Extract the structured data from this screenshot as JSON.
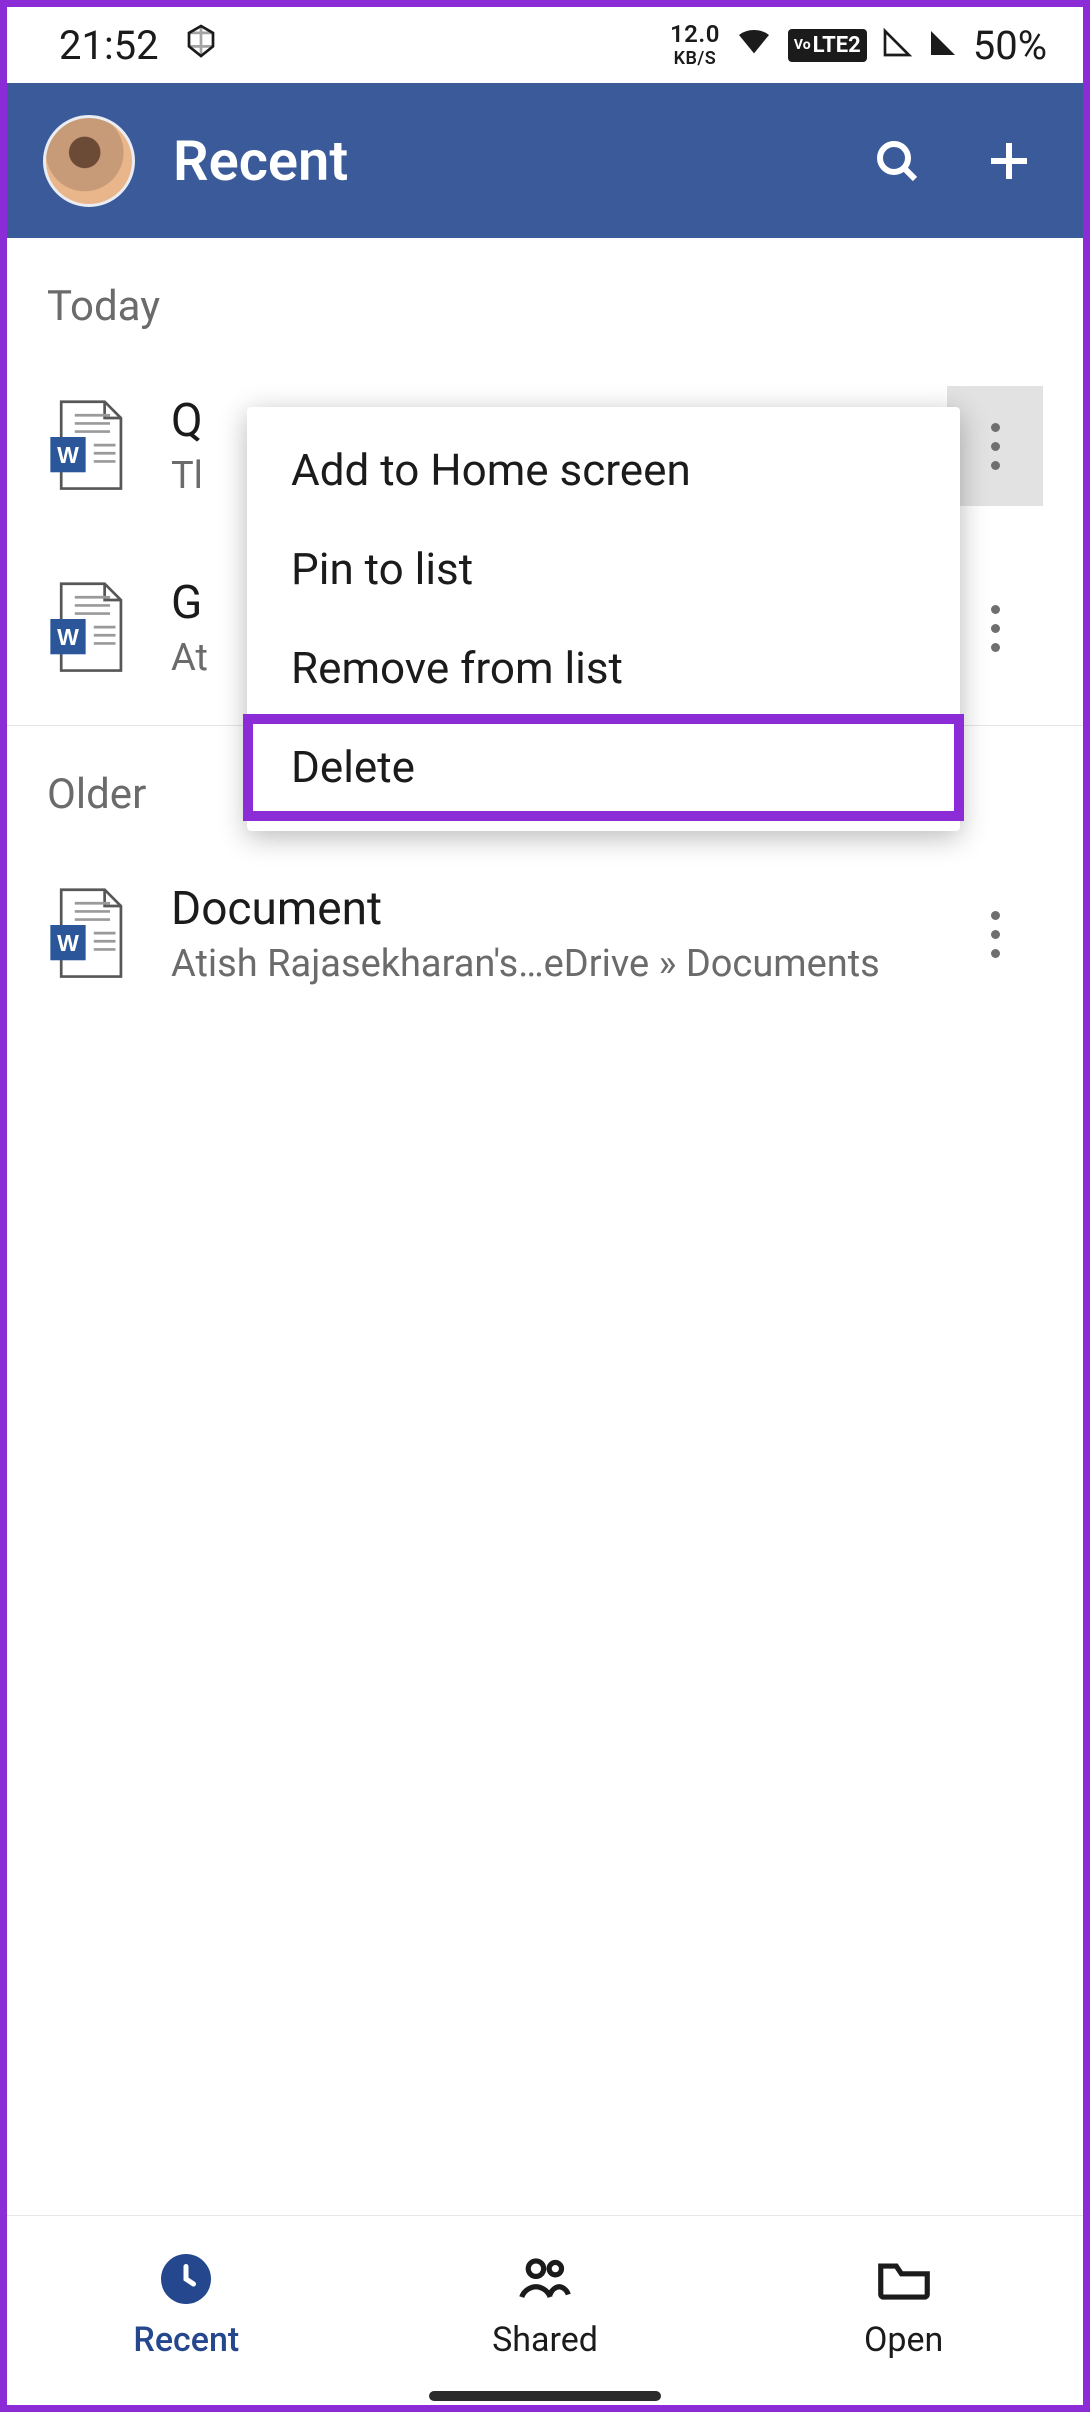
{
  "status_bar": {
    "time": "21:52",
    "data_rate_top": "12.0",
    "data_rate_bot": "KB/S",
    "volte_label": "LTE2",
    "battery_percent": "50%"
  },
  "app_bar": {
    "title": "Recent"
  },
  "sections": {
    "today_label": "Today",
    "older_label": "Older"
  },
  "files": {
    "item0": {
      "title": "Q",
      "subtitle": "Tl"
    },
    "item1": {
      "title": "G",
      "subtitle": "At"
    },
    "item2": {
      "title": "Document",
      "subtitle": "Atish Rajasekharan's…eDrive » Documents"
    }
  },
  "context_menu": {
    "add_home": "Add to Home screen",
    "pin_list": "Pin to list",
    "remove_list": "Remove from list",
    "delete": "Delete"
  },
  "bottom_nav": {
    "recent": "Recent",
    "shared": "Shared",
    "open": "Open"
  }
}
